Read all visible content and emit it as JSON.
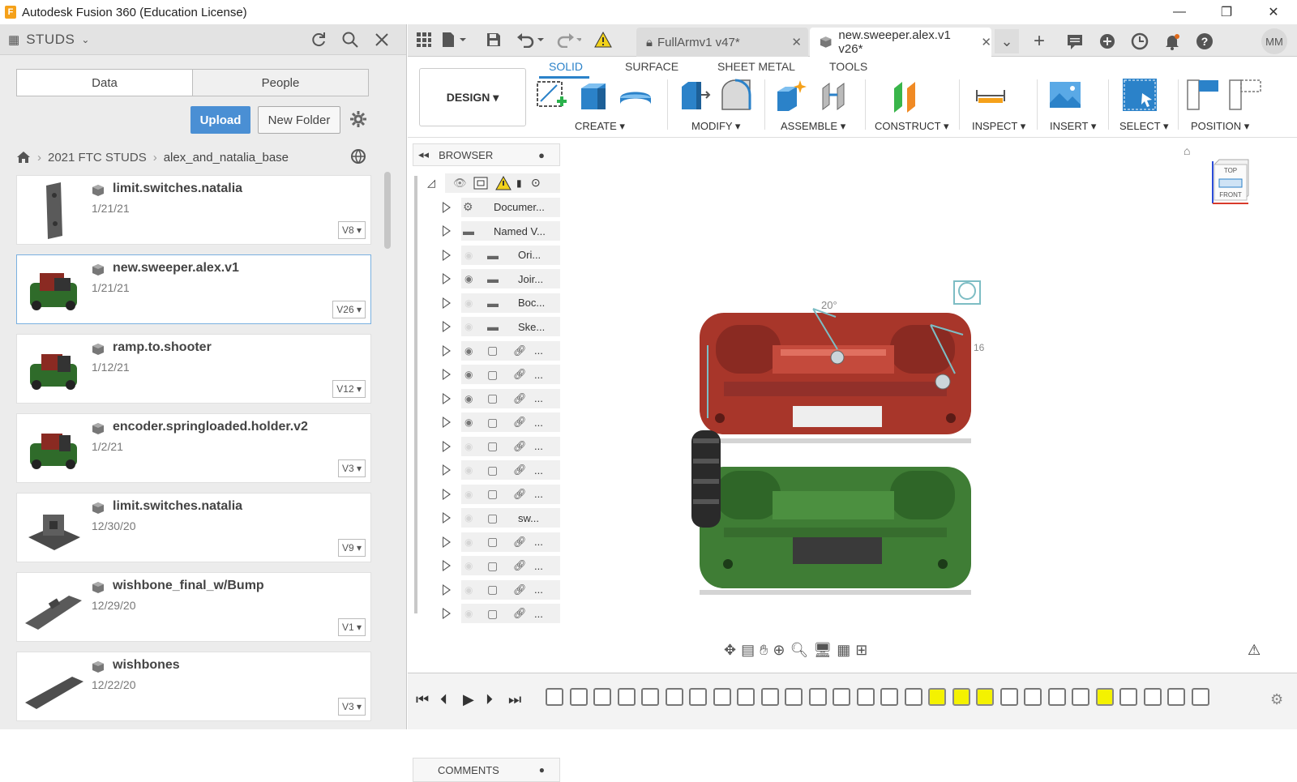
{
  "window": {
    "title": "Autodesk Fusion 360 (Education License)",
    "controls": [
      "—",
      "❐",
      "✕"
    ]
  },
  "data_panel": {
    "project": "STUDS",
    "tabs": [
      "Data",
      "People"
    ],
    "upload_label": "Upload",
    "new_folder_label": "New Folder",
    "breadcrumb": [
      "2021 FTC STUDS",
      "alex_and_natalia_base"
    ],
    "items": [
      {
        "name": "limit.switches.natalia",
        "date": "1/21/21",
        "version": "V8"
      },
      {
        "name": "new.sweeper.alex.v1",
        "date": "1/21/21",
        "version": "V26"
      },
      {
        "name": "ramp.to.shooter",
        "date": "1/12/21",
        "version": "V12"
      },
      {
        "name": "encoder.springloaded.holder.v2",
        "date": "1/2/21",
        "version": "V3"
      },
      {
        "name": "limit.switches.natalia",
        "date": "12/30/20",
        "version": "V9"
      },
      {
        "name": "wishbone_final_w/Bump",
        "date": "12/29/20",
        "version": "V1"
      },
      {
        "name": "wishbones",
        "date": "12/22/20",
        "version": "V3"
      }
    ]
  },
  "doc_tabs": [
    {
      "label": "FullArmv1 v47*",
      "locked": true
    },
    {
      "label": "new.sweeper.alex.v1 v26*",
      "active": true
    }
  ],
  "user_initials": "MM",
  "workspace_tabs": [
    "SOLID",
    "SURFACE",
    "SHEET METAL",
    "TOOLS"
  ],
  "design_label": "DESIGN ▾",
  "tool_groups": [
    "CREATE ▾",
    "MODIFY ▾",
    "ASSEMBLE ▾",
    "CONSTRUCT ▾",
    "INSPECT ▾",
    "INSERT ▾",
    "SELECT ▾",
    "POSITION ▾"
  ],
  "browser": {
    "title": "BROWSER",
    "rows": [
      "Documer...",
      "Named V...",
      "Ori...",
      "Joir...",
      "Boc...",
      "Ske...",
      "...",
      "...",
      "...",
      "...",
      "...",
      "...",
      "...",
      "sw...",
      "...",
      "...",
      "...",
      "..."
    ]
  },
  "comments_label": "COMMENTS",
  "viewcube": {
    "top": "TOP",
    "front": "FRONT"
  },
  "annotations": {
    "angle1": "20°",
    "angle2": "16"
  },
  "colors": {
    "accent": "#2b82c9",
    "red_part": "#a8362a",
    "green_part": "#3f7d35",
    "highlight": "#f4f200"
  }
}
